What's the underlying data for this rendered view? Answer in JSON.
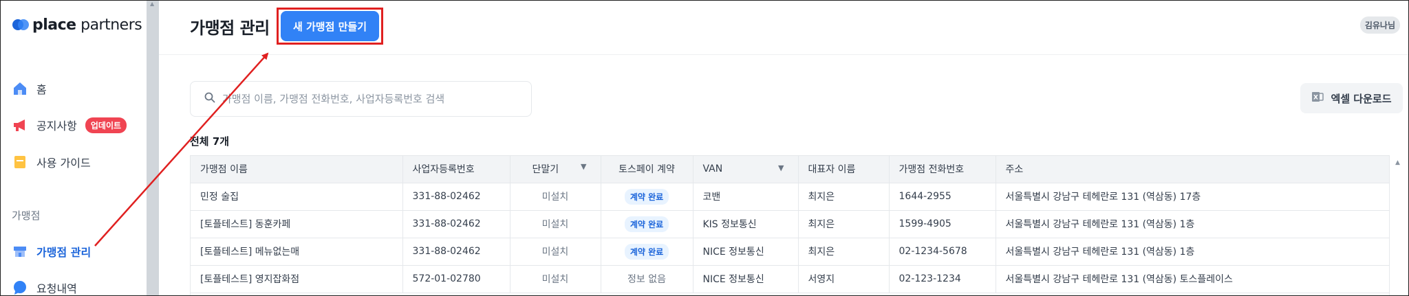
{
  "app": {
    "logo_main": "place",
    "logo_light": " partners"
  },
  "sidebar": {
    "items": [
      {
        "label": "홈",
        "icon": "home-icon"
      },
      {
        "label": "공지사항",
        "icon": "megaphone-icon",
        "badge": "업데이트"
      },
      {
        "label": "사용 가이드",
        "icon": "guide-icon"
      },
      {
        "label": "가맹점 관리",
        "icon": "store-icon",
        "active": true
      },
      {
        "label": "요청내역",
        "icon": "chat-icon"
      }
    ],
    "section_label": "가맹점"
  },
  "header": {
    "title": "가맹점 관리",
    "create_button": "새 가맹점 만들기",
    "user_name": "김유나님"
  },
  "search": {
    "placeholder": "가맹점 이름, 가맹점 전화번호, 사업자등록번호 검색"
  },
  "excel_button": "엑셀 다운로드",
  "total_label": "전체 7개",
  "table": {
    "columns": [
      "가맹점 이름",
      "사업자등록번호",
      "단말기",
      "토스페이 계약",
      "VAN",
      "대표자 이름",
      "가맹점 전화번호",
      "주소"
    ],
    "rows": [
      [
        "민정 술집",
        "331-88-02462",
        "미설치",
        "계약 완료",
        "코밴",
        "최지은",
        "1644-2955",
        "서울특별시 강남구 테헤란로 131 (역삼동) 17층"
      ],
      [
        "[토플테스트] 동훈카페",
        "331-88-02462",
        "미설치",
        "계약 완료",
        "KIS 정보통신",
        "최지은",
        "1599-4905",
        "서울특별시 강남구 테헤란로 131 (역삼동) 1층"
      ],
      [
        "[토플테스트] 메뉴없는매",
        "331-88-02462",
        "미설치",
        "계약 완료",
        "NICE 정보통신",
        "최지은",
        "02-1234-5678",
        "서울특별시 강남구 테헤란로 131 (역삼동) 1층"
      ],
      [
        "[토플테스트] 영지잡화점",
        "572-01-02780",
        "미설치",
        "정보 없음",
        "NICE 정보통신",
        "서영지",
        "02-123-1234",
        "서울특별시 강남구 테헤란로 131 (역삼동) 토스플레이스"
      ]
    ]
  },
  "colors": {
    "primary": "#3182f6",
    "highlight_outline": "#e02020",
    "badge_red": "#f04452",
    "active_nav": "#1b64da"
  }
}
